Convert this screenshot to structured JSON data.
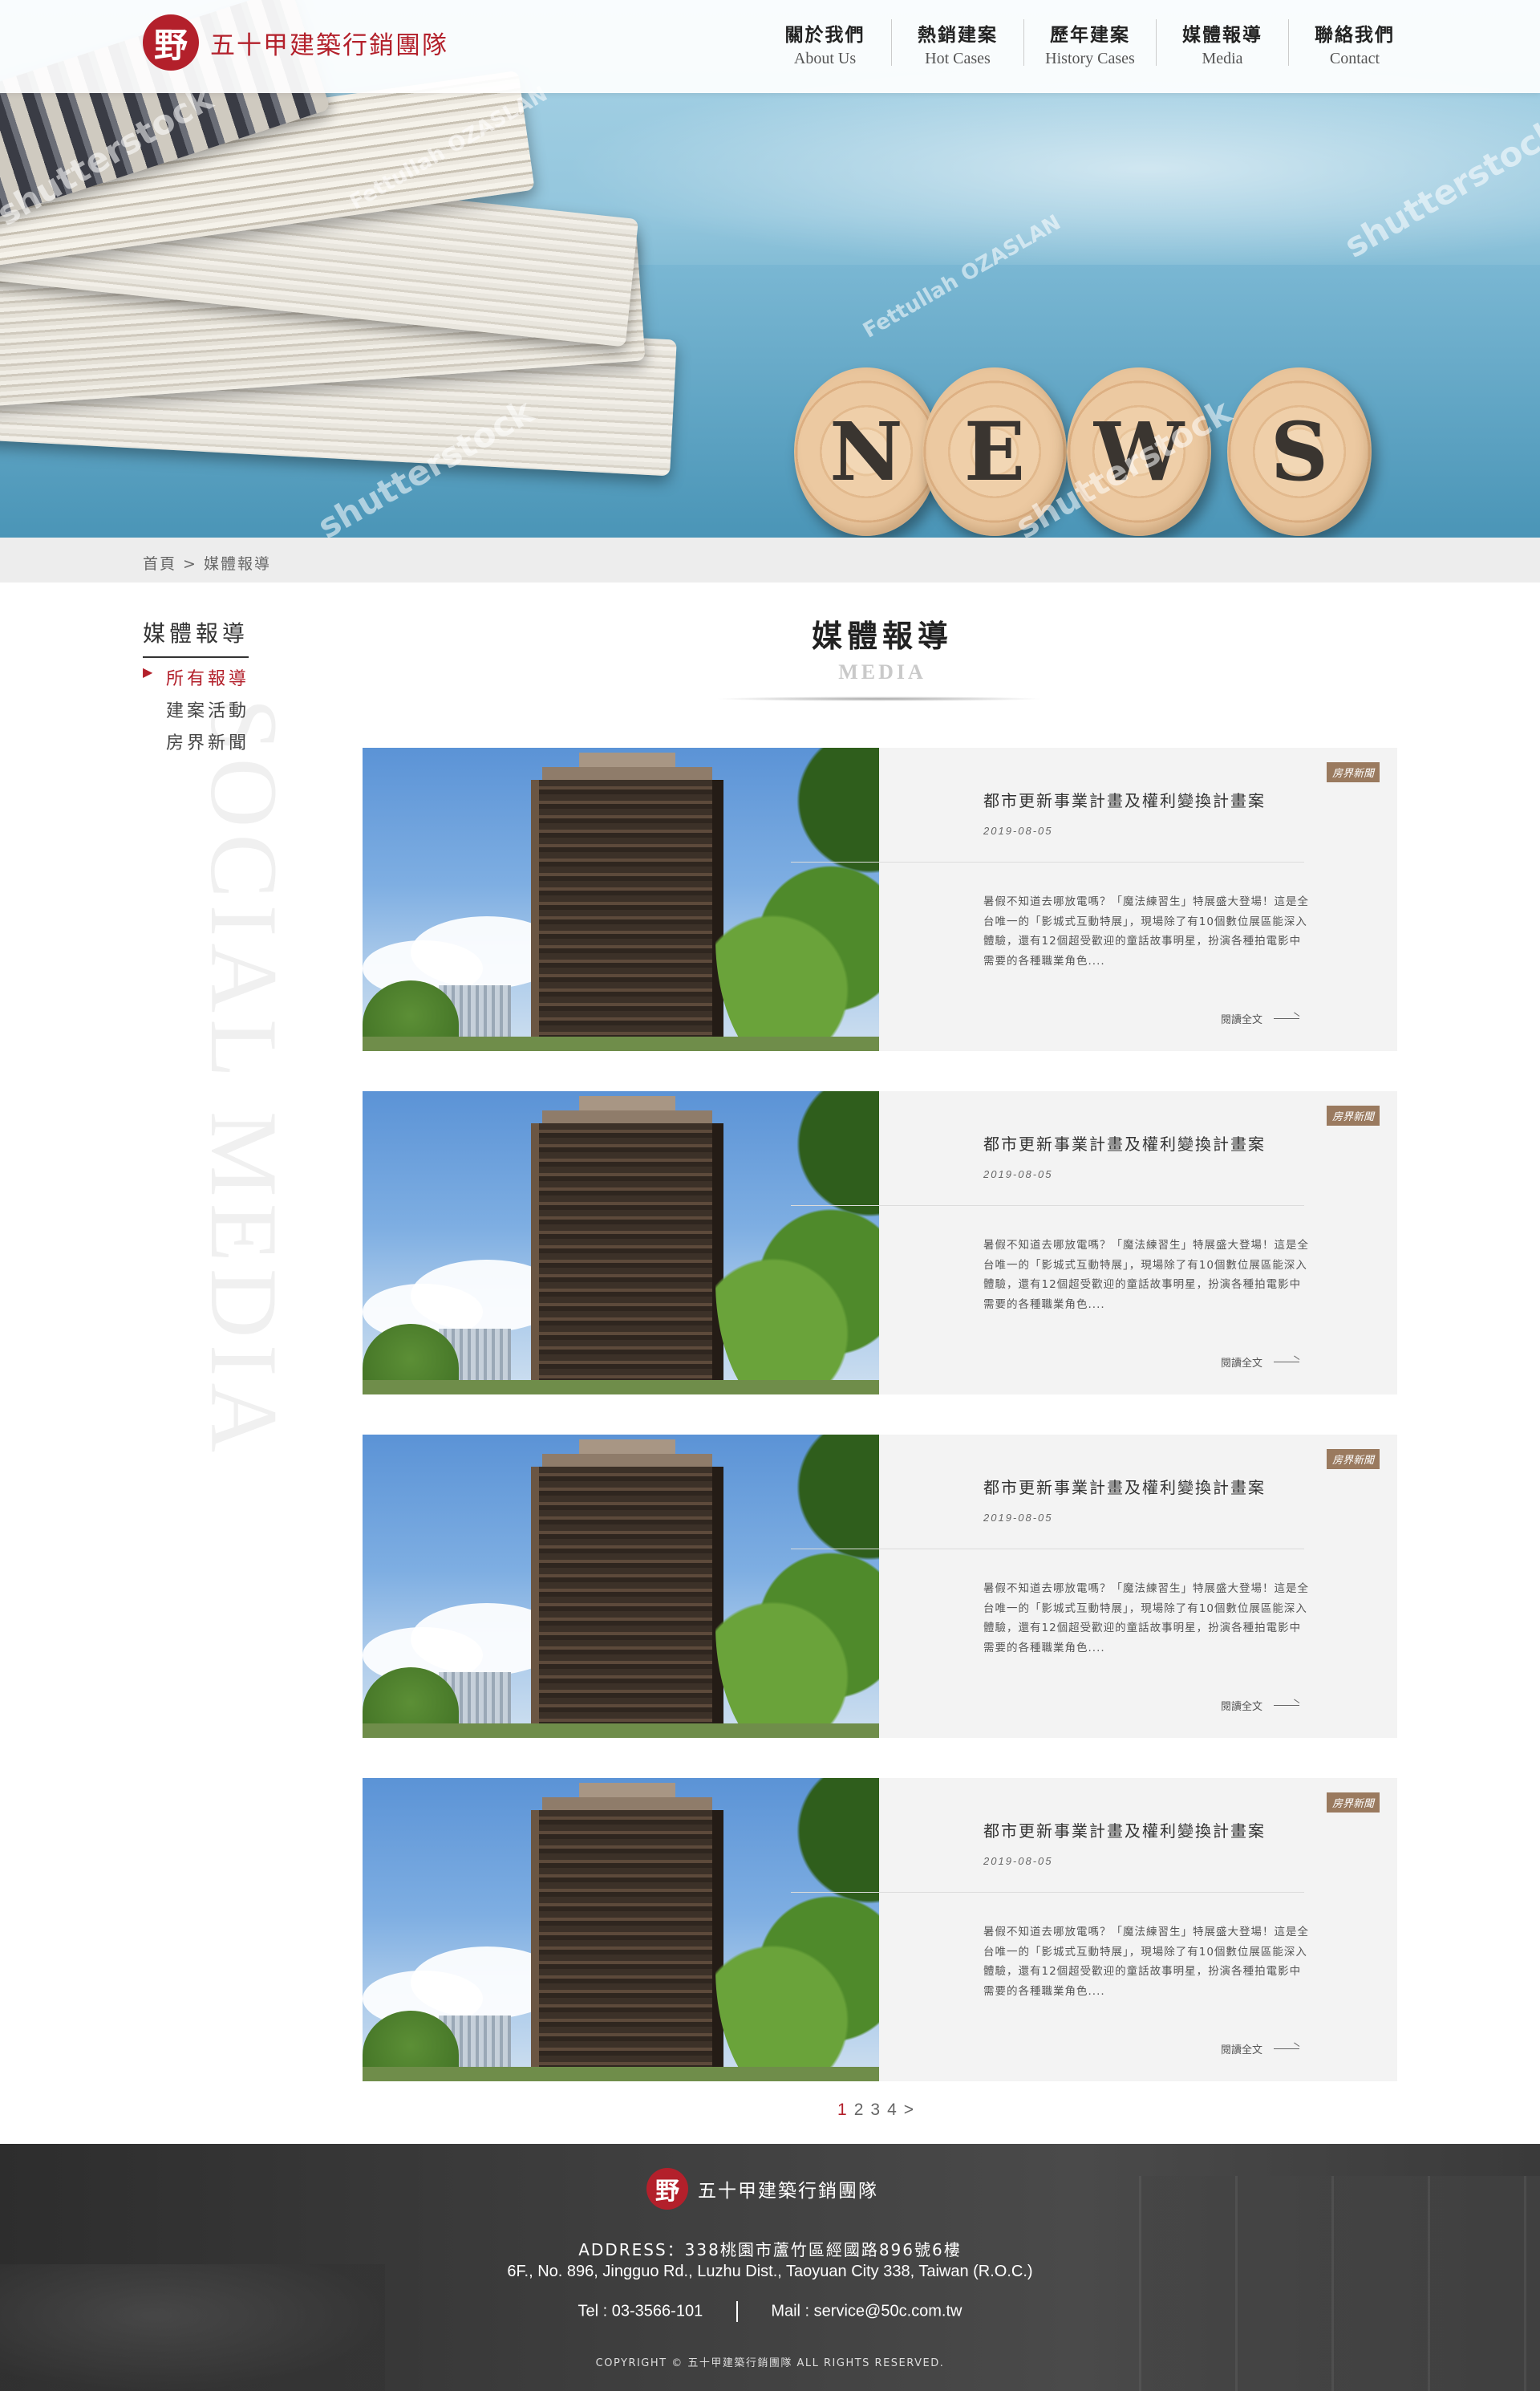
{
  "header": {
    "logo_glyph": "野",
    "brand": "五十甲建築行銷團隊",
    "nav": [
      {
        "zh": "關於我們",
        "en": "About Us"
      },
      {
        "zh": "熱銷建案",
        "en": "Hot Cases"
      },
      {
        "zh": "歷年建案",
        "en": "History Cases"
      },
      {
        "zh": "媒體報導",
        "en": "Media"
      },
      {
        "zh": "聯絡我們",
        "en": "Contact"
      }
    ]
  },
  "banner": {
    "letters": [
      "N",
      "E",
      "W",
      "S"
    ],
    "watermarks": [
      "shutterstock",
      "Fettullah OZASLAN",
      "shutterstock",
      "Fettullah OZASLAN",
      "shutterstock",
      "shutterstock"
    ]
  },
  "breadcrumb": "首頁 > 媒體報導",
  "sidebar": {
    "title": "媒體報導",
    "items": [
      "所有報導",
      "建案活動",
      "房界新聞"
    ],
    "bg_text": "SOCIAL MEDIA"
  },
  "section": {
    "title_zh": "媒體報導",
    "title_en": "MEDIA"
  },
  "articles": [
    {
      "tag": "房界新聞",
      "title": "都市更新事業計畫及權利變換計畫案",
      "date": "2019-08-05",
      "excerpt": "暑假不知道去哪放電嗎？「魔法練習生」特展盛大登場！這是全台唯一的「影城式互動特展」，現場除了有10個數位展區能深入體驗，還有12個超受歡迎的童話故事明星，扮演各種拍電影中需要的各種職業角色....",
      "read_more": "閱讀全文"
    },
    {
      "tag": "房界新聞",
      "title": "都市更新事業計畫及權利變換計畫案",
      "date": "2019-08-05",
      "excerpt": "暑假不知道去哪放電嗎？「魔法練習生」特展盛大登場！這是全台唯一的「影城式互動特展」，現場除了有10個數位展區能深入體驗，還有12個超受歡迎的童話故事明星，扮演各種拍電影中需要的各種職業角色....",
      "read_more": "閱讀全文"
    },
    {
      "tag": "房界新聞",
      "title": "都市更新事業計畫及權利變換計畫案",
      "date": "2019-08-05",
      "excerpt": "暑假不知道去哪放電嗎？「魔法練習生」特展盛大登場！這是全台唯一的「影城式互動特展」，現場除了有10個數位展區能深入體驗，還有12個超受歡迎的童話故事明星，扮演各種拍電影中需要的各種職業角色....",
      "read_more": "閱讀全文"
    },
    {
      "tag": "房界新聞",
      "title": "都市更新事業計畫及權利變換計畫案",
      "date": "2019-08-05",
      "excerpt": "暑假不知道去哪放電嗎？「魔法練習生」特展盛大登場！這是全台唯一的「影城式互動特展」，現場除了有10個數位展區能深入體驗，還有12個超受歡迎的童話故事明星，扮演各種拍電影中需要的各種職業角色....",
      "read_more": "閱讀全文"
    }
  ],
  "pagination": {
    "pages": [
      "1",
      "2",
      "3",
      "4"
    ],
    "current": "1",
    "next": ">"
  },
  "footer": {
    "logo_glyph": "野",
    "brand": "五十甲建築行銷團隊",
    "address_label": "ADDRESS：",
    "address_zh": "338桃園市蘆竹區經國路896號6樓",
    "address_en": "6F., No. 896, Jingguo Rd., Luzhu Dist., Taoyuan City 338, Taiwan (R.O.C.)",
    "tel": "Tel : 03-3566-101",
    "mail": "Mail : service@50c.com.tw",
    "copyright": "COPYRIGHT © 五十甲建築行銷團隊 ALL RIGHTS RESERVED."
  },
  "colors": {
    "brand_red": "#b3202b",
    "tag_brown": "#9a7a5f",
    "card_bg": "#f3f3f3",
    "footer_bg": "#3a3a3a"
  }
}
